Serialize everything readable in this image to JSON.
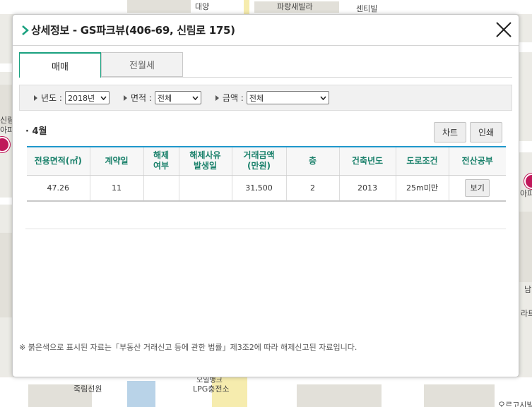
{
  "map": {
    "labels": [
      "대양",
      "파랑새빌라",
      "센티빌",
      "신림",
      "아파",
      "아파",
      "남",
      "라트",
      "죽림선원",
      "오일뱅크",
      "LPG충전소",
      "오르고시빌"
    ]
  },
  "modal": {
    "title": "상세정보 - GS파크뷰(406-69, 신림로 175)",
    "close_icon": "close-icon",
    "tabs": [
      {
        "label": "매매",
        "active": true
      },
      {
        "label": "전월세",
        "active": false
      }
    ],
    "filters": {
      "year_label": "년도 :",
      "year_value": "2018년",
      "area_label": "면적 :",
      "area_value": "전체",
      "price_label": "금액 :",
      "price_value": "전체"
    },
    "month_label": "· 4월",
    "buttons": {
      "chart": "차트",
      "print": "인쇄"
    },
    "table": {
      "headers": [
        "전용면적(㎡)",
        "계약일",
        "해제\n여부",
        "해제사유\n발생일",
        "거래금액\n(만원)",
        "층",
        "건축년도",
        "도로조건",
        "전산공부"
      ],
      "rows": [
        [
          "47.26",
          "11",
          "",
          "",
          "31,500",
          "2",
          "2013",
          "25m미만",
          "보기"
        ]
      ]
    },
    "footnote": "※ 붉은색으로 표시된 자료는「부동산 거래신고 등에 관한 법률」제3조2에 따라 해제신고된 자료입니다."
  },
  "colors": {
    "accent_green": "#19a17f",
    "header_text": "#19806a",
    "table_top_border": "#1f98cc"
  }
}
